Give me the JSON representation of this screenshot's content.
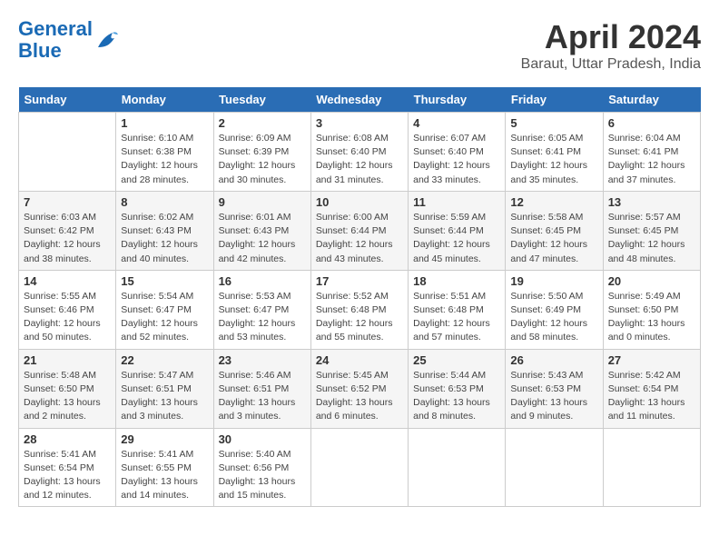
{
  "logo": {
    "line1": "General",
    "line2": "Blue"
  },
  "title": "April 2024",
  "subtitle": "Baraut, Uttar Pradesh, India",
  "weekdays": [
    "Sunday",
    "Monday",
    "Tuesday",
    "Wednesday",
    "Thursday",
    "Friday",
    "Saturday"
  ],
  "weeks": [
    [
      {
        "day": "",
        "info": ""
      },
      {
        "day": "1",
        "info": "Sunrise: 6:10 AM\nSunset: 6:38 PM\nDaylight: 12 hours\nand 28 minutes."
      },
      {
        "day": "2",
        "info": "Sunrise: 6:09 AM\nSunset: 6:39 PM\nDaylight: 12 hours\nand 30 minutes."
      },
      {
        "day": "3",
        "info": "Sunrise: 6:08 AM\nSunset: 6:40 PM\nDaylight: 12 hours\nand 31 minutes."
      },
      {
        "day": "4",
        "info": "Sunrise: 6:07 AM\nSunset: 6:40 PM\nDaylight: 12 hours\nand 33 minutes."
      },
      {
        "day": "5",
        "info": "Sunrise: 6:05 AM\nSunset: 6:41 PM\nDaylight: 12 hours\nand 35 minutes."
      },
      {
        "day": "6",
        "info": "Sunrise: 6:04 AM\nSunset: 6:41 PM\nDaylight: 12 hours\nand 37 minutes."
      }
    ],
    [
      {
        "day": "7",
        "info": "Sunrise: 6:03 AM\nSunset: 6:42 PM\nDaylight: 12 hours\nand 38 minutes."
      },
      {
        "day": "8",
        "info": "Sunrise: 6:02 AM\nSunset: 6:43 PM\nDaylight: 12 hours\nand 40 minutes."
      },
      {
        "day": "9",
        "info": "Sunrise: 6:01 AM\nSunset: 6:43 PM\nDaylight: 12 hours\nand 42 minutes."
      },
      {
        "day": "10",
        "info": "Sunrise: 6:00 AM\nSunset: 6:44 PM\nDaylight: 12 hours\nand 43 minutes."
      },
      {
        "day": "11",
        "info": "Sunrise: 5:59 AM\nSunset: 6:44 PM\nDaylight: 12 hours\nand 45 minutes."
      },
      {
        "day": "12",
        "info": "Sunrise: 5:58 AM\nSunset: 6:45 PM\nDaylight: 12 hours\nand 47 minutes."
      },
      {
        "day": "13",
        "info": "Sunrise: 5:57 AM\nSunset: 6:45 PM\nDaylight: 12 hours\nand 48 minutes."
      }
    ],
    [
      {
        "day": "14",
        "info": "Sunrise: 5:55 AM\nSunset: 6:46 PM\nDaylight: 12 hours\nand 50 minutes."
      },
      {
        "day": "15",
        "info": "Sunrise: 5:54 AM\nSunset: 6:47 PM\nDaylight: 12 hours\nand 52 minutes."
      },
      {
        "day": "16",
        "info": "Sunrise: 5:53 AM\nSunset: 6:47 PM\nDaylight: 12 hours\nand 53 minutes."
      },
      {
        "day": "17",
        "info": "Sunrise: 5:52 AM\nSunset: 6:48 PM\nDaylight: 12 hours\nand 55 minutes."
      },
      {
        "day": "18",
        "info": "Sunrise: 5:51 AM\nSunset: 6:48 PM\nDaylight: 12 hours\nand 57 minutes."
      },
      {
        "day": "19",
        "info": "Sunrise: 5:50 AM\nSunset: 6:49 PM\nDaylight: 12 hours\nand 58 minutes."
      },
      {
        "day": "20",
        "info": "Sunrise: 5:49 AM\nSunset: 6:50 PM\nDaylight: 13 hours\nand 0 minutes."
      }
    ],
    [
      {
        "day": "21",
        "info": "Sunrise: 5:48 AM\nSunset: 6:50 PM\nDaylight: 13 hours\nand 2 minutes."
      },
      {
        "day": "22",
        "info": "Sunrise: 5:47 AM\nSunset: 6:51 PM\nDaylight: 13 hours\nand 3 minutes."
      },
      {
        "day": "23",
        "info": "Sunrise: 5:46 AM\nSunset: 6:51 PM\nDaylight: 13 hours\nand 3 minutes."
      },
      {
        "day": "24",
        "info": "Sunrise: 5:45 AM\nSunset: 6:52 PM\nDaylight: 13 hours\nand 6 minutes."
      },
      {
        "day": "25",
        "info": "Sunrise: 5:44 AM\nSunset: 6:53 PM\nDaylight: 13 hours\nand 8 minutes."
      },
      {
        "day": "26",
        "info": "Sunrise: 5:43 AM\nSunset: 6:53 PM\nDaylight: 13 hours\nand 9 minutes."
      },
      {
        "day": "27",
        "info": "Sunrise: 5:42 AM\nSunset: 6:54 PM\nDaylight: 13 hours\nand 11 minutes."
      }
    ],
    [
      {
        "day": "28",
        "info": "Sunrise: 5:41 AM\nSunset: 6:54 PM\nDaylight: 13 hours\nand 12 minutes."
      },
      {
        "day": "29",
        "info": "Sunrise: 5:41 AM\nSunset: 6:55 PM\nDaylight: 13 hours\nand 14 minutes."
      },
      {
        "day": "30",
        "info": "Sunrise: 5:40 AM\nSunset: 6:56 PM\nDaylight: 13 hours\nand 15 minutes."
      },
      {
        "day": "",
        "info": ""
      },
      {
        "day": "",
        "info": ""
      },
      {
        "day": "",
        "info": ""
      },
      {
        "day": "",
        "info": ""
      }
    ]
  ]
}
